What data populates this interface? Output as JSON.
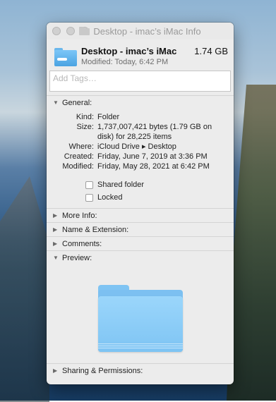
{
  "window": {
    "title": "Desktop - imac’s iMac Info"
  },
  "header": {
    "name": "Desktop - imac’s iMac",
    "size": "1.74 GB",
    "modified": "Modified: Today, 6:42 PM"
  },
  "tags": {
    "placeholder": "Add Tags…"
  },
  "sections": {
    "general": "General:",
    "more_info": "More Info:",
    "name_extension": "Name & Extension:",
    "comments": "Comments:",
    "preview": "Preview:",
    "sharing": "Sharing & Permissions:"
  },
  "general": {
    "kind_label": "Kind:",
    "kind": "Folder",
    "size_label": "Size:",
    "size": "1,737,007,421 bytes (1.79 GB on disk) for 28,225 items",
    "where_label": "Where:",
    "where": "iCloud Drive ▸ Desktop",
    "created_label": "Created:",
    "created": "Friday, June 7, 2019 at 3:36 PM",
    "modified_label": "Modified:",
    "modified": "Friday, May 28, 2021 at 6:42 PM",
    "shared_folder": "Shared folder",
    "locked": "Locked"
  },
  "icons": {
    "expanded": "triangle-down",
    "collapsed": "triangle-right",
    "folder": "folder-icon"
  },
  "colors": {
    "folder_blue": "#7cc6f7",
    "window_bg": "#ececec"
  }
}
